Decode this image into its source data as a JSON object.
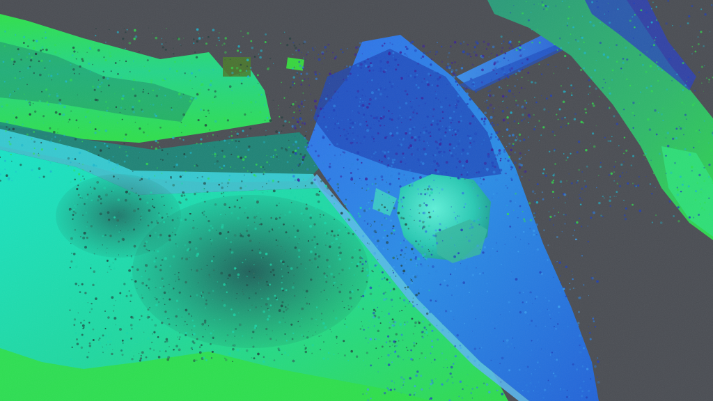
{
  "scene": {
    "kind": "point-cloud-3d-view",
    "colormap": "height",
    "colors": {
      "background": "#4a4d53",
      "low": "#2ee04a",
      "mid_low": "#18d6a8",
      "mid": "#1ab7cf",
      "mid_high": "#2a7fe0",
      "high": "#1f3fb8",
      "peak": "#3a1f9a",
      "shadow": "#1d3b3a"
    },
    "regions": [
      "ground-upper-left",
      "ground-lower-left",
      "ground-center-dark",
      "concrete-slab",
      "rock-boulder",
      "beam",
      "embankment-right",
      "scatter-noise"
    ]
  }
}
